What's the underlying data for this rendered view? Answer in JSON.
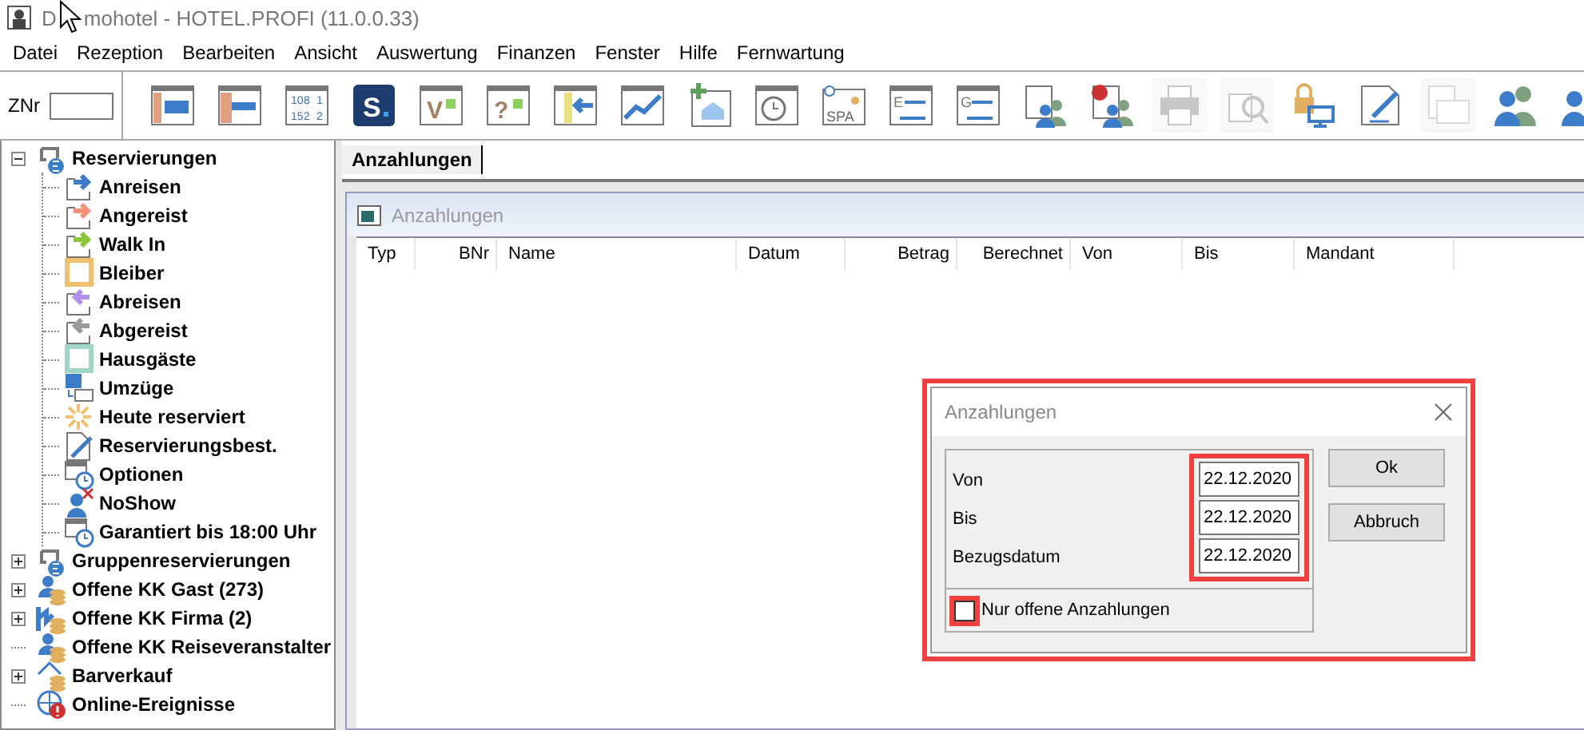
{
  "window": {
    "title_parts": [
      "D",
      "mohotel - HOTEL.PROFI (11.0.0.33)"
    ]
  },
  "menu": [
    "Datei",
    "Rezeption",
    "Bearbeiten",
    "Ansicht",
    "Auswertung",
    "Finanzen",
    "Fenster",
    "Hilfe",
    "Fernwartung"
  ],
  "toolbar": {
    "field_label": "ZNr",
    "buttons": [
      {
        "kind": "grid",
        "disabled": false
      },
      {
        "kind": "bars",
        "disabled": false
      },
      {
        "kind": "numbers",
        "disabled": false,
        "glyphs": [
          "10",
          "8",
          "1",
          "15",
          "2",
          "2"
        ]
      },
      {
        "kind": "logo",
        "disabled": false,
        "glyphs": [
          "S"
        ]
      },
      {
        "kind": "letter-grid",
        "disabled": false,
        "glyphs": [
          "V"
        ]
      },
      {
        "kind": "letter-grid",
        "disabled": false,
        "glyphs": [
          "?"
        ]
      },
      {
        "kind": "arrow-grid",
        "disabled": false
      },
      {
        "kind": "chart",
        "disabled": false
      },
      {
        "kind": "house-plus",
        "disabled": false
      },
      {
        "kind": "clock",
        "disabled": false
      },
      {
        "kind": "spa",
        "disabled": false,
        "glyphs": [
          "SPA"
        ]
      },
      {
        "kind": "list",
        "disabled": false,
        "glyphs": [
          "E"
        ]
      },
      {
        "kind": "list",
        "disabled": false,
        "glyphs": [
          "G"
        ]
      },
      {
        "kind": "people-doc",
        "disabled": false
      },
      {
        "kind": "people-alert",
        "disabled": false
      },
      {
        "kind": "printer",
        "disabled": true
      },
      {
        "kind": "preview",
        "disabled": true
      },
      {
        "kind": "lock",
        "disabled": false
      },
      {
        "kind": "edit",
        "disabled": false
      },
      {
        "kind": "mail",
        "disabled": true
      },
      {
        "kind": "people",
        "disabled": false
      },
      {
        "kind": "person",
        "disabled": false
      }
    ]
  },
  "tree": [
    {
      "label": "Reservierungen",
      "kind": "group",
      "expanded": true,
      "children": [
        {
          "label": "Anreisen",
          "kind": "arrival",
          "color": "#3d7cc9"
        },
        {
          "label": "Angereist",
          "kind": "arrival",
          "color": "#f4917b"
        },
        {
          "label": "Walk In",
          "kind": "arrival",
          "color": "#8cc63f"
        },
        {
          "label": "Bleiber",
          "kind": "square",
          "color": "#f0c070"
        },
        {
          "label": "Abreisen",
          "kind": "departure",
          "color": "#b38ff0"
        },
        {
          "label": "Abgereist",
          "kind": "departure",
          "color": "#9a9a9a"
        },
        {
          "label": "Hausgäste",
          "kind": "square",
          "color": "#9fd4c8"
        },
        {
          "label": "Umzüge",
          "kind": "move",
          "color": "#3d7cc9"
        },
        {
          "label": "Heute reserviert",
          "kind": "sun",
          "color": "#f0c070"
        },
        {
          "label": "Reservierungsbest.",
          "kind": "edit",
          "color": "#3d7cc9"
        },
        {
          "label": "Optionen",
          "kind": "calendar",
          "color": "#3d7cc9"
        },
        {
          "label": "NoShow",
          "kind": "noshow",
          "color": "#3d7cc9"
        },
        {
          "label": "Garantiert bis 18:00 Uhr",
          "kind": "calendar",
          "color": "#3d7cc9"
        }
      ]
    },
    {
      "label": "Gruppenreservierungen",
      "kind": "group",
      "expanded": false
    },
    {
      "label": "Offene KK Gast (273)",
      "kind": "coins-person",
      "expanded": false
    },
    {
      "label": "Offene KK Firma (2)",
      "kind": "coins-firm",
      "expanded": false
    },
    {
      "label": "Offene KK Reiseveranstalter",
      "kind": "coins-people"
    },
    {
      "label": "Barverkauf",
      "kind": "coins-house",
      "expanded": false
    },
    {
      "label": "Online-Ereignisse",
      "kind": "globe"
    }
  ],
  "tabs": [
    {
      "label": "Anzahlungen",
      "selected": true
    }
  ],
  "list_window": {
    "title": "Anzahlungen",
    "columns": [
      {
        "label": "Typ",
        "kind": "text"
      },
      {
        "label": "BNr",
        "kind": "number"
      },
      {
        "label": "Name",
        "kind": "text"
      },
      {
        "label": "Datum",
        "kind": "text"
      },
      {
        "label": "Betrag",
        "kind": "number"
      },
      {
        "label": "Berechnet",
        "kind": "number"
      },
      {
        "label": "Von",
        "kind": "text"
      },
      {
        "label": "Bis",
        "kind": "text"
      },
      {
        "label": "Mandant",
        "kind": "text"
      }
    ]
  },
  "dialog": {
    "title": "Anzahlungen",
    "highlighted": true,
    "fields": [
      {
        "label": "Von",
        "value": "22.12.2020"
      },
      {
        "label": "Bis",
        "value": "22.12.2020"
      },
      {
        "label": "Bezugsdatum",
        "value": "22.12.2020"
      }
    ],
    "fields_highlighted": true,
    "checkbox": {
      "label": "Nur offene Anzahlungen",
      "checked": false,
      "highlighted": true
    },
    "buttons": [
      "Ok",
      "Abbruch"
    ]
  }
}
